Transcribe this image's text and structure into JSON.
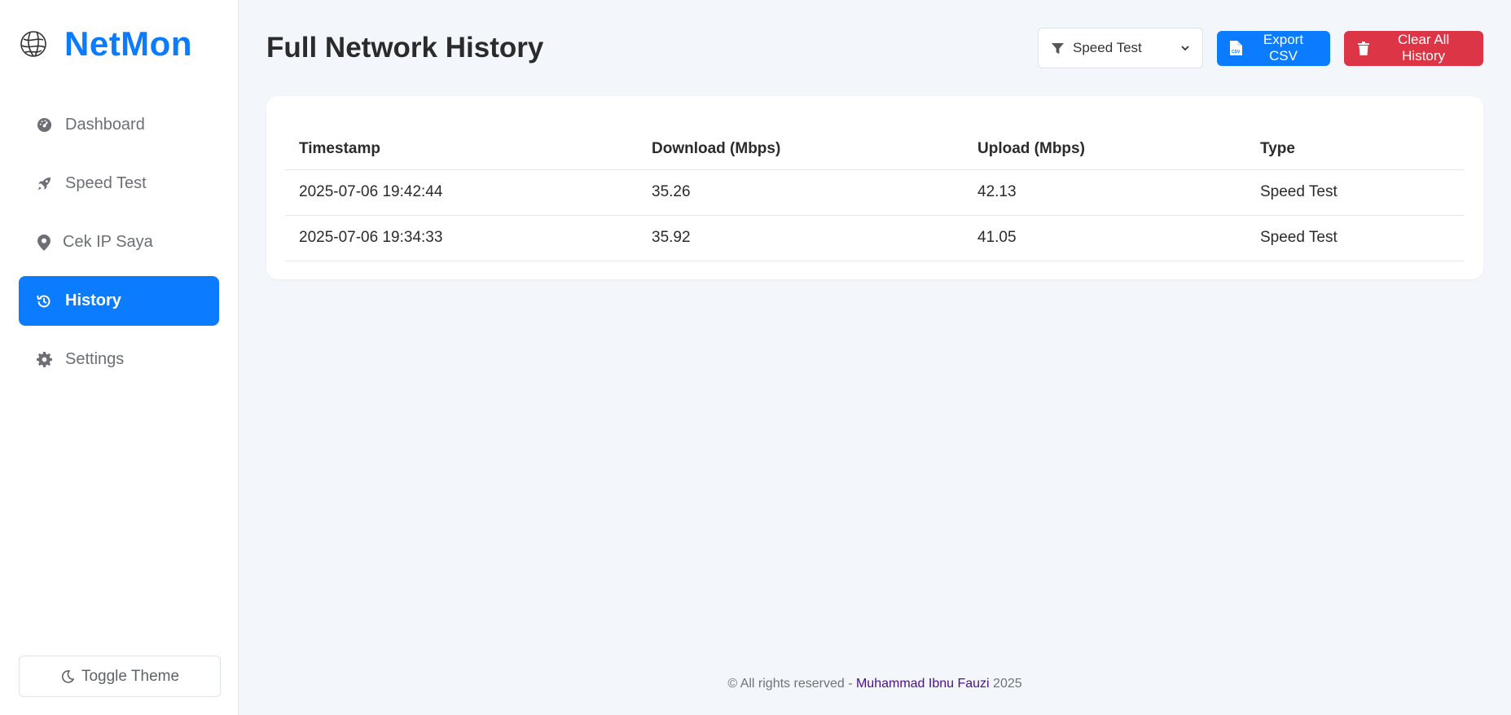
{
  "brand": {
    "name": "NetMon",
    "color": "#0b7cff"
  },
  "sidebar": {
    "items": [
      {
        "label": "Dashboard",
        "icon": "gauge-icon",
        "active": false
      },
      {
        "label": "Speed Test",
        "icon": "rocket-icon",
        "active": false
      },
      {
        "label": "Cek IP Saya",
        "icon": "map-pin-icon",
        "active": false
      },
      {
        "label": "History",
        "icon": "history-icon",
        "active": true
      },
      {
        "label": "Settings",
        "icon": "gear-icon",
        "active": false
      }
    ],
    "toggle_theme_label": "Toggle Theme"
  },
  "main": {
    "title": "Full Network History",
    "filter": {
      "selected": "Speed Test",
      "icon": "filter-icon"
    },
    "export_label": "Export CSV",
    "clear_label": "Clear All History"
  },
  "table": {
    "headers": [
      "Timestamp",
      "Download (Mbps)",
      "Upload (Mbps)",
      "Type"
    ],
    "rows": [
      [
        "2025-07-06 19:42:44",
        "35.26",
        "42.13",
        "Speed Test"
      ],
      [
        "2025-07-06 19:34:33",
        "35.92",
        "41.05",
        "Speed Test"
      ]
    ]
  },
  "footer": {
    "prefix": "© All rights reserved - ",
    "author": "Muhammad Ibnu Fauzi",
    "suffix": " 2025"
  },
  "colors": {
    "accent": "#0b7cff",
    "danger": "#dc3545",
    "author": "#4b0f8a"
  }
}
